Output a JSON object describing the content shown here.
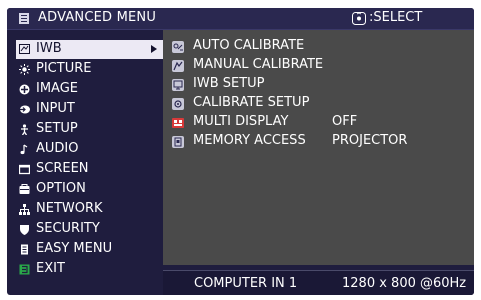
{
  "header": {
    "title": "ADVANCED MENU",
    "select_hint": ":SELECT",
    "select_icon": "joystick-select-icon",
    "menu_icon": "menu-list-icon"
  },
  "left_menu": {
    "items": [
      {
        "label": "IWB",
        "icon": "iwb-icon",
        "selected": true
      },
      {
        "label": "PICTURE",
        "icon": "picture-icon"
      },
      {
        "label": "IMAGE",
        "icon": "image-icon"
      },
      {
        "label": "INPUT",
        "icon": "input-icon"
      },
      {
        "label": "SETUP",
        "icon": "setup-icon"
      },
      {
        "label": "AUDIO",
        "icon": "audio-icon"
      },
      {
        "label": "SCREEN",
        "icon": "screen-icon"
      },
      {
        "label": "OPTION",
        "icon": "option-icon"
      },
      {
        "label": "NETWORK",
        "icon": "network-icon"
      },
      {
        "label": "SECURITY",
        "icon": "security-icon"
      },
      {
        "label": "EASY MENU",
        "icon": "easy-menu-icon"
      },
      {
        "label": "EXIT",
        "icon": "exit-icon"
      }
    ]
  },
  "submenu": {
    "items": [
      {
        "label": "AUTO CALIBRATE",
        "value": "",
        "icon": "auto-calibrate-icon"
      },
      {
        "label": "MANUAL CALIBRATE",
        "value": "",
        "icon": "manual-calibrate-icon"
      },
      {
        "label": "IWB SETUP",
        "value": "",
        "icon": "iwb-setup-icon"
      },
      {
        "label": "CALIBRATE SETUP",
        "value": "",
        "icon": "calibrate-setup-icon"
      },
      {
        "label": "MULTI DISPLAY",
        "value": "OFF",
        "icon": "multi-display-icon"
      },
      {
        "label": "MEMORY ACCESS",
        "value": "PROJECTOR",
        "icon": "memory-access-icon"
      }
    ]
  },
  "status": {
    "input": "COMPUTER IN 1",
    "signal": "1280 x 800 @60Hz"
  },
  "colors": {
    "background": "#1f1d3e",
    "panel": "#4a4a4a",
    "selected_bg": "#ece9f4",
    "text": "#ffffff"
  }
}
